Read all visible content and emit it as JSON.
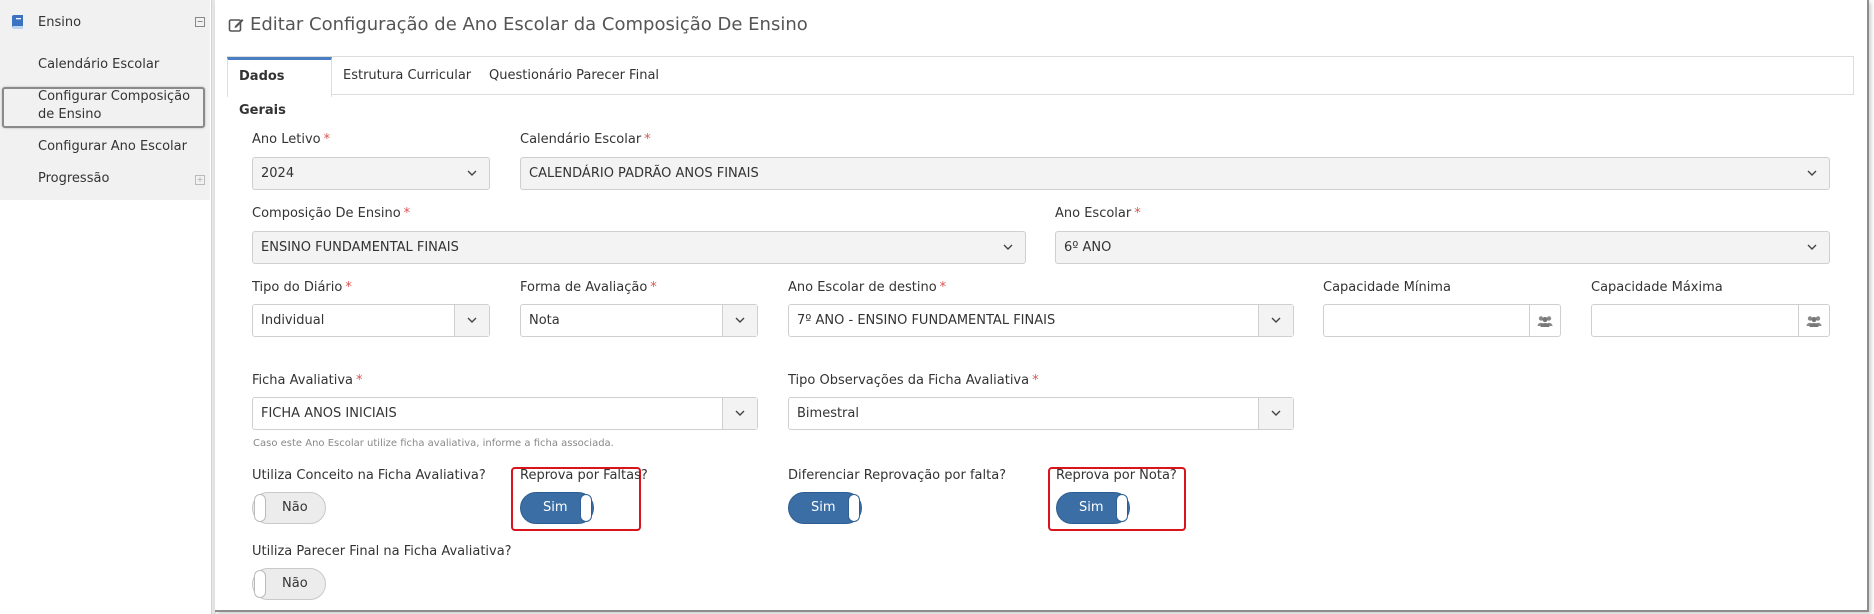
{
  "sidebar": {
    "section_label": "Ensino",
    "items": [
      {
        "label": "Calendário Escolar"
      },
      {
        "label": "Configurar Composição de Ensino"
      },
      {
        "label": "Configurar Ano Escolar"
      },
      {
        "label": "Progressão"
      }
    ]
  },
  "page": {
    "title": "Editar Configuração de Ano Escolar da Composição De Ensino"
  },
  "tabs": [
    {
      "label": "Dados Gerais",
      "active": true
    },
    {
      "label": "Estrutura Curricular",
      "active": false
    },
    {
      "label": "Questionário Parecer Final",
      "active": false
    }
  ],
  "form": {
    "ano_letivo": {
      "label": "Ano Letivo",
      "value": "2024"
    },
    "calendario_escolar": {
      "label": "Calendário Escolar",
      "value": "CALENDÁRIO PADRÃO ANOS FINAIS"
    },
    "composicao_ensino": {
      "label": "Composição De Ensino",
      "value": "ENSINO FUNDAMENTAL FINAIS"
    },
    "ano_escolar": {
      "label": "Ano Escolar",
      "value": "6º ANO"
    },
    "tipo_diario": {
      "label": "Tipo do Diário",
      "value": "Individual"
    },
    "forma_avaliacao": {
      "label": "Forma de Avaliação",
      "value": "Nota"
    },
    "ano_escolar_destino": {
      "label": "Ano Escolar de destino",
      "value": "7º ANO - ENSINO FUNDAMENTAL FINAIS"
    },
    "capacidade_minima": {
      "label": "Capacidade Mínima",
      "value": ""
    },
    "capacidade_maxima": {
      "label": "Capacidade Máxima",
      "value": ""
    },
    "ficha_avaliativa": {
      "label": "Ficha Avaliativa",
      "value": "FICHA ANOS INICIAIS",
      "help": "Caso este Ano Escolar utilize ficha avaliativa, informe a ficha associada."
    },
    "tipo_observacoes": {
      "label": "Tipo Observações da Ficha Avaliativa",
      "value": "Bimestral"
    },
    "utiliza_conceito": {
      "label": "Utiliza Conceito na Ficha Avaliativa?",
      "state": "Não"
    },
    "reprova_faltas": {
      "label": "Reprova por Faltas?",
      "state": "Sim"
    },
    "diferenciar_reprovacao": {
      "label": "Diferenciar Reprovação por falta?",
      "state": "Sim"
    },
    "reprova_nota": {
      "label": "Reprova por Nota?",
      "state": "Sim"
    },
    "utiliza_parecer": {
      "label": "Utiliza Parecer Final na Ficha Avaliativa?",
      "state": "Não"
    }
  },
  "colors": {
    "accent": "#3a6ea5",
    "highlight": "#d9141b",
    "required": "#d9534f"
  }
}
